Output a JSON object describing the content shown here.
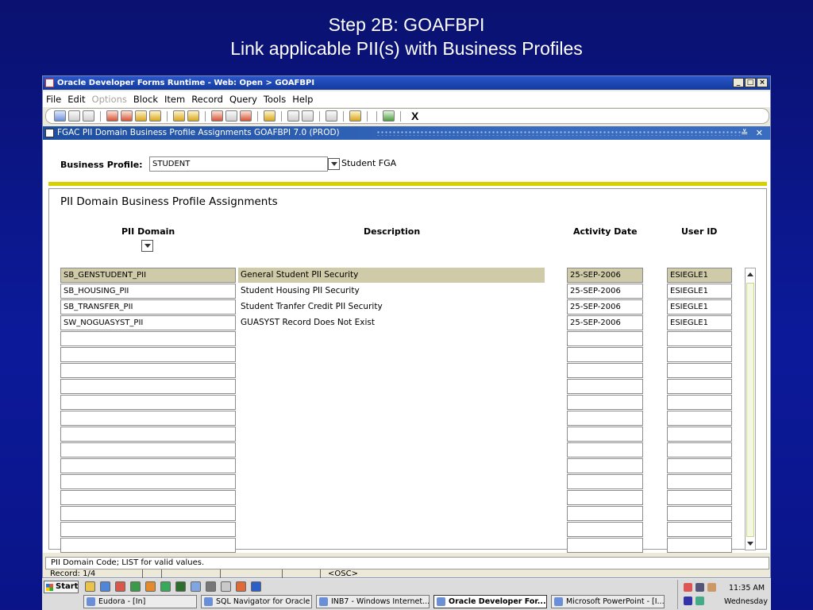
{
  "slide": {
    "title_line1": "Step 2B: GOAFBPI",
    "title_line2": "Link applicable PII(s) with Business Profiles"
  },
  "window": {
    "title": "Oracle Developer Forms Runtime - Web:  Open > GOAFBPI",
    "buttons": [
      "_",
      "□",
      "×"
    ]
  },
  "menu": [
    "File",
    "Edit",
    "Options",
    "Block",
    "Item",
    "Record",
    "Query",
    "Tools",
    "Help"
  ],
  "toolbar": {
    "icons": [
      "save-icon",
      "rollback-icon",
      "print-icon",
      "insert-record-icon",
      "remove-record-icon",
      "previous-block-icon",
      "next-block-icon",
      "previous-record-icon",
      "next-record-icon",
      "enter-query-icon",
      "execute-query-icon",
      "cancel-query-icon",
      "help-icon",
      "exit-icon"
    ],
    "exit_label": "X"
  },
  "form": {
    "title": "FGAC PII Domain Business Profile Assignments  GOAFBPI  7.0  (PROD)",
    "controls": "≚ ✕",
    "business_profile_label": "Business Profile:",
    "business_profile_value": "STUDENT",
    "business_profile_desc": "Student FGA",
    "section_title": "PII Domain Business Profile Assignments",
    "columns": {
      "pii": "PII Domain",
      "desc": "Description",
      "date": "Activity Date",
      "user": "User ID"
    },
    "rows": [
      {
        "pii": "SB_GENSTUDENT_PII",
        "desc": "General Student PII Security",
        "date": "25-SEP-2006",
        "user": "ESIEGLE1"
      },
      {
        "pii": "SB_HOUSING_PII",
        "desc": "Student Housing PII Security",
        "date": "25-SEP-2006",
        "user": "ESIEGLE1"
      },
      {
        "pii": "SB_TRANSFER_PII",
        "desc": "Student Tranfer Credit PII Security",
        "date": "25-SEP-2006",
        "user": "ESIEGLE1"
      },
      {
        "pii": "SW_NOGUASYST_PII",
        "desc": "GUASYST Record Does Not Exist",
        "date": "25-SEP-2006",
        "user": "ESIEGLE1"
      }
    ]
  },
  "status": {
    "hint": "PII Domain Code; LIST for valid values.",
    "record": "Record: 1/4",
    "osc": "<OSC>"
  },
  "taskbar": {
    "start": "Start",
    "tasks": [
      "Eudora - [In]",
      "SQL Navigator for Oracle",
      "INB7 - Windows Internet...",
      "Oracle Developer For...",
      "Microsoft PowerPoint - [I..."
    ],
    "time": "11:35 AM",
    "day": "Wednesday"
  }
}
